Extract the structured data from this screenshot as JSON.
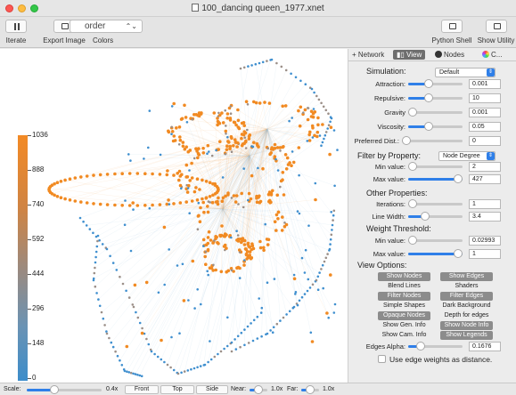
{
  "window": {
    "title": "100_dancing queen_1977.xnet"
  },
  "toolbar": {
    "iterate_label": "Iterate",
    "export_label": "Export Image",
    "order_value": "order",
    "colors_label": "Colors",
    "python_shell_label": "Python Shell",
    "show_utility_label": "Show Utility"
  },
  "legend": {
    "labels": [
      "1036",
      "888",
      "740",
      "592",
      "444",
      "296",
      "148",
      "0"
    ],
    "gradient_top": "#f38a25",
    "gradient_bottom": "#3d8dca"
  },
  "tabs": {
    "network": "Network",
    "view": "View",
    "nodes": "Nodes",
    "colors": "C..."
  },
  "simulation": {
    "label": "Simulation:",
    "preset": "Default",
    "attraction": {
      "label": "Attraction:",
      "value": "0.001",
      "fraction": 0.35
    },
    "repulsive": {
      "label": "Repulsive:",
      "value": "10",
      "fraction": 0.35
    },
    "gravity": {
      "label": "Gravity",
      "value": "0.001",
      "fraction": 0.0
    },
    "viscosity": {
      "label": "Viscosity:",
      "value": "0.05",
      "fraction": 0.35
    },
    "preferred": {
      "label": "Preferred Dist.:",
      "value": "0",
      "fraction": 0.0
    }
  },
  "filter": {
    "label": "Filter by Property:",
    "property": "Node Degree",
    "min": {
      "label": "Min value:",
      "value": "2",
      "fraction": 0.0
    },
    "max": {
      "label": "Max value:",
      "value": "427",
      "fraction": 1.0
    }
  },
  "other": {
    "label": "Other Properties:",
    "iterations": {
      "label": "Iterations:",
      "value": "1",
      "fraction": 0.0
    },
    "line_width": {
      "label": "Line Width:",
      "value": "3.4",
      "fraction": 0.28
    }
  },
  "weight": {
    "label": "Weight Threshold:",
    "min": {
      "label": "Min value:",
      "value": "0.02993",
      "fraction": 0.0
    },
    "max": {
      "label": "Max value:",
      "value": "1",
      "fraction": 1.0
    }
  },
  "view_options": {
    "label": "View Options:",
    "buttons": [
      {
        "label": "Show Nodes",
        "on": true
      },
      {
        "label": "Show Edges",
        "on": true
      },
      {
        "label": "Blend Lines",
        "on": false
      },
      {
        "label": "Shaders",
        "on": false
      },
      {
        "label": "Filter Nodes",
        "on": true
      },
      {
        "label": "Filter Edges",
        "on": true
      },
      {
        "label": "Simple Shapes",
        "on": false
      },
      {
        "label": "Dark Background",
        "on": false
      },
      {
        "label": "Opaque Nodes",
        "on": true
      },
      {
        "label": "Depth for edges",
        "on": false
      },
      {
        "label": "Show Gen. Info",
        "on": false
      },
      {
        "label": "Show Node Info",
        "on": true
      },
      {
        "label": "Show Cam. Info",
        "on": false
      },
      {
        "label": "Show Legends",
        "on": true
      }
    ],
    "edges_alpha": {
      "label": "Edges Alpha:",
      "value": "0.1676",
      "fraction": 0.17
    },
    "edge_weights_label": "Use edge weights as distance."
  },
  "bottom": {
    "scale_label": "Scale:",
    "scale_value": "0.4x",
    "scale_fraction": 0.35,
    "front_label": "Front",
    "top_label": "Top",
    "side_label": "Side",
    "near_label": "Near:",
    "near_value": "1.0x",
    "far_label": "Far:",
    "far_value": "1.0x"
  }
}
